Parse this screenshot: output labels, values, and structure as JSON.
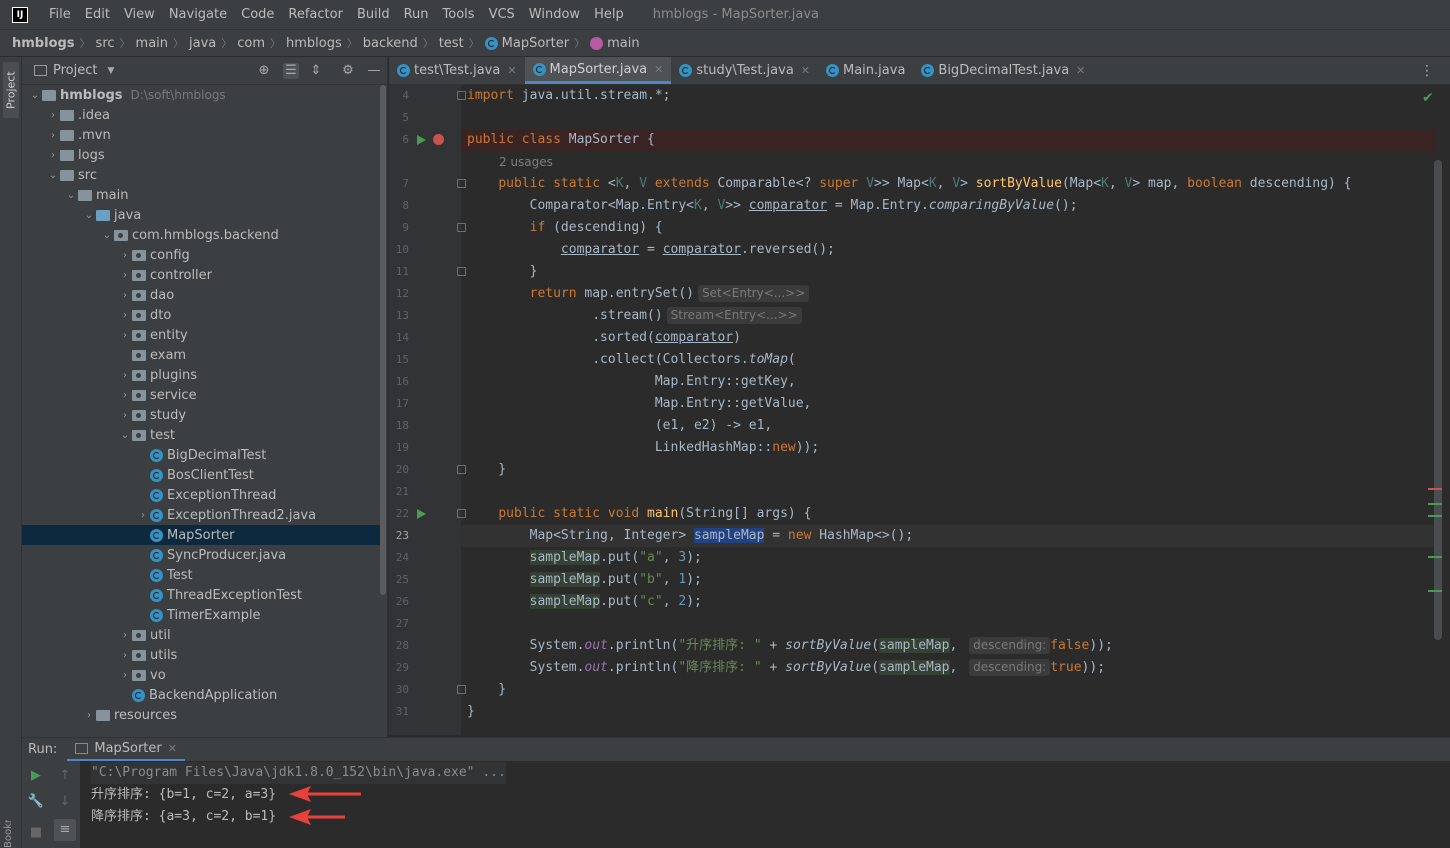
{
  "app": {
    "logo": "IJ",
    "window_title": "hmblogs - MapSorter.java"
  },
  "menu": [
    "File",
    "Edit",
    "View",
    "Navigate",
    "Code",
    "Refactor",
    "Build",
    "Run",
    "Tools",
    "VCS",
    "Window",
    "Help"
  ],
  "breadcrumb": [
    "hmblogs",
    "src",
    "main",
    "java",
    "com",
    "hmblogs",
    "backend",
    "test",
    "MapSorter",
    "main"
  ],
  "sidebar": {
    "stripe_label": "Project",
    "bookmarks_label": "Bookmarks"
  },
  "project": {
    "title": "Project",
    "tree": [
      {
        "label": "hmblogs",
        "hint": "D:\\soft\\hmblogs",
        "depth": 0,
        "kind": "folder",
        "expand": "open",
        "bold": true
      },
      {
        "label": ".idea",
        "depth": 1,
        "kind": "folder",
        "expand": "closed"
      },
      {
        "label": ".mvn",
        "depth": 1,
        "kind": "folder",
        "expand": "closed"
      },
      {
        "label": "logs",
        "depth": 1,
        "kind": "folder",
        "expand": "closed"
      },
      {
        "label": "src",
        "depth": 1,
        "kind": "folder",
        "expand": "open"
      },
      {
        "label": "main",
        "depth": 2,
        "kind": "folder",
        "expand": "open"
      },
      {
        "label": "java",
        "depth": 3,
        "kind": "src",
        "expand": "open"
      },
      {
        "label": "com.hmblogs.backend",
        "depth": 4,
        "kind": "pkg",
        "expand": "open"
      },
      {
        "label": "config",
        "depth": 5,
        "kind": "pkg",
        "expand": "closed"
      },
      {
        "label": "controller",
        "depth": 5,
        "kind": "pkg",
        "expand": "closed"
      },
      {
        "label": "dao",
        "depth": 5,
        "kind": "pkg",
        "expand": "closed"
      },
      {
        "label": "dto",
        "depth": 5,
        "kind": "pkg",
        "expand": "closed"
      },
      {
        "label": "entity",
        "depth": 5,
        "kind": "pkg",
        "expand": "closed"
      },
      {
        "label": "exam",
        "depth": 5,
        "kind": "pkg",
        "expand": "none"
      },
      {
        "label": "plugins",
        "depth": 5,
        "kind": "pkg",
        "expand": "closed"
      },
      {
        "label": "service",
        "depth": 5,
        "kind": "pkg",
        "expand": "closed"
      },
      {
        "label": "study",
        "depth": 5,
        "kind": "pkg",
        "expand": "closed"
      },
      {
        "label": "test",
        "depth": 5,
        "kind": "pkg",
        "expand": "open"
      },
      {
        "label": "BigDecimalTest",
        "depth": 6,
        "kind": "class",
        "expand": "none"
      },
      {
        "label": "BosClientTest",
        "depth": 6,
        "kind": "class",
        "expand": "none"
      },
      {
        "label": "ExceptionThread",
        "depth": 6,
        "kind": "class",
        "expand": "none"
      },
      {
        "label": "ExceptionThread2.java",
        "depth": 6,
        "kind": "class",
        "expand": "closed"
      },
      {
        "label": "MapSorter",
        "depth": 6,
        "kind": "class",
        "expand": "none",
        "selected": true
      },
      {
        "label": "SyncProducer.java",
        "depth": 6,
        "kind": "class",
        "expand": "none"
      },
      {
        "label": "Test",
        "depth": 6,
        "kind": "class",
        "expand": "none"
      },
      {
        "label": "ThreadExceptionTest",
        "depth": 6,
        "kind": "class",
        "expand": "none"
      },
      {
        "label": "TimerExample",
        "depth": 6,
        "kind": "class",
        "expand": "none"
      },
      {
        "label": "util",
        "depth": 5,
        "kind": "pkg",
        "expand": "closed"
      },
      {
        "label": "utils",
        "depth": 5,
        "kind": "pkg",
        "expand": "closed"
      },
      {
        "label": "vo",
        "depth": 5,
        "kind": "pkg",
        "expand": "closed"
      },
      {
        "label": "BackendApplication",
        "depth": 5,
        "kind": "class",
        "expand": "none"
      },
      {
        "label": "resources",
        "depth": 3,
        "kind": "folder",
        "expand": "closed"
      }
    ]
  },
  "tabs": [
    {
      "label": "test\\Test.java",
      "active": false
    },
    {
      "label": "MapSorter.java",
      "active": true
    },
    {
      "label": "study\\Test.java",
      "active": false
    },
    {
      "label": "Main.java",
      "active": false
    },
    {
      "label": "BigDecimalTest.java",
      "active": false
    }
  ],
  "editor": {
    "line_numbers": [
      "4",
      "5",
      "6",
      "",
      "7",
      "8",
      "9",
      "10",
      "11",
      "12",
      "13",
      "14",
      "15",
      "16",
      "17",
      "18",
      "19",
      "20",
      "21",
      "22",
      "23",
      "24",
      "25",
      "26",
      "27",
      "28",
      "29",
      "30",
      "31"
    ],
    "usages_hint": "2 usages",
    "inlay_set_entry": "Set<Entry<...>>",
    "inlay_stream_entry": "Stream<Entry<...>>",
    "inlay_descending": "descending:",
    "str_ascending": "\"升序排序: \"",
    "str_descending": "\"降序排序: \"",
    "str_a": "\"a\"",
    "str_b": "\"b\"",
    "str_c": "\"c\"",
    "num_3": "3",
    "num_1": "1",
    "num_2": "2"
  },
  "run": {
    "label": "Run:",
    "tab": "MapSorter",
    "console": [
      "\"C:\\Program Files\\Java\\jdk1.8.0_152\\bin\\java.exe\" ...",
      "升序排序: {b=1, c=2, a=3}",
      "降序排序: {a=3, c=2, b=1}"
    ]
  },
  "colors": {
    "accent": "#4a88c7",
    "keyword": "#cc7832",
    "string": "#6a8759",
    "number": "#6897bb",
    "function": "#ffc66d",
    "arrow": "#e8403a",
    "run_green": "#499c54",
    "breakpoint": "#c75450"
  }
}
